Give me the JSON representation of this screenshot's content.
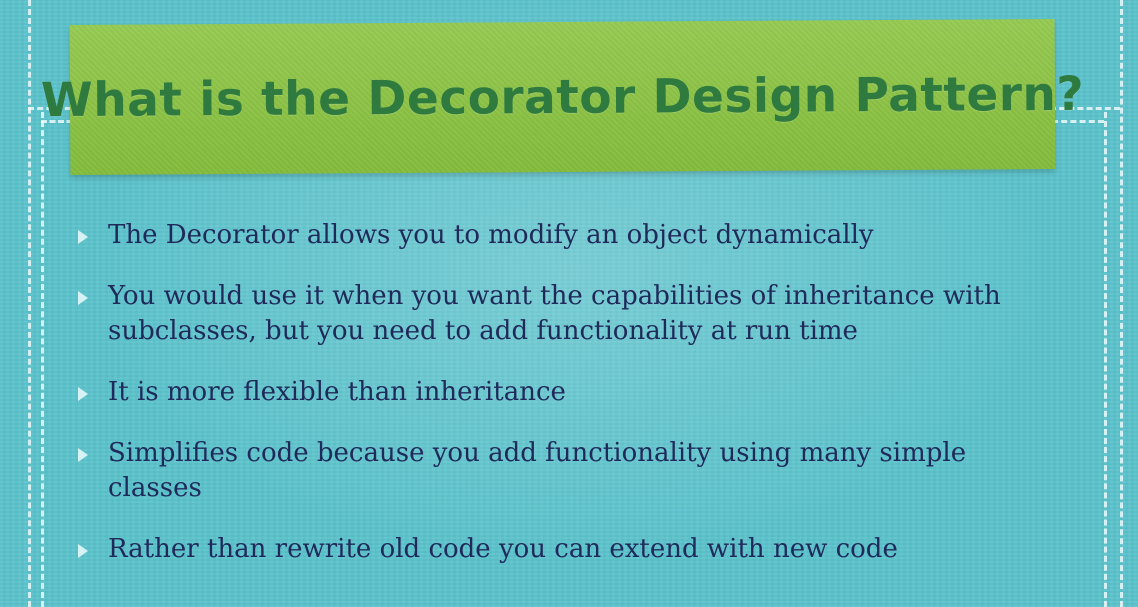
{
  "slide": {
    "title": "What is the Decorator Design Pattern?",
    "bullets": [
      "The Decorator allows you to modify an object dynamically",
      "You would use it when you want the capabilities of inheritance with subclasses, but you need to add functionality at run time",
      "It is more flexible than inheritance",
      "Simplifies code because you add functionality using many simple classes",
      "Rather than rewrite old code you can extend with new code"
    ]
  },
  "colors": {
    "background": "#5bc3cc",
    "banner": "#8ac43f",
    "title_text": "#2f7a3f",
    "bullet_text": "#1f2a5a",
    "bullet_marker": "#d6f2f4",
    "stitch": "#ffffff"
  },
  "icons": {
    "bullet_marker": "triangle-bullet-icon"
  }
}
